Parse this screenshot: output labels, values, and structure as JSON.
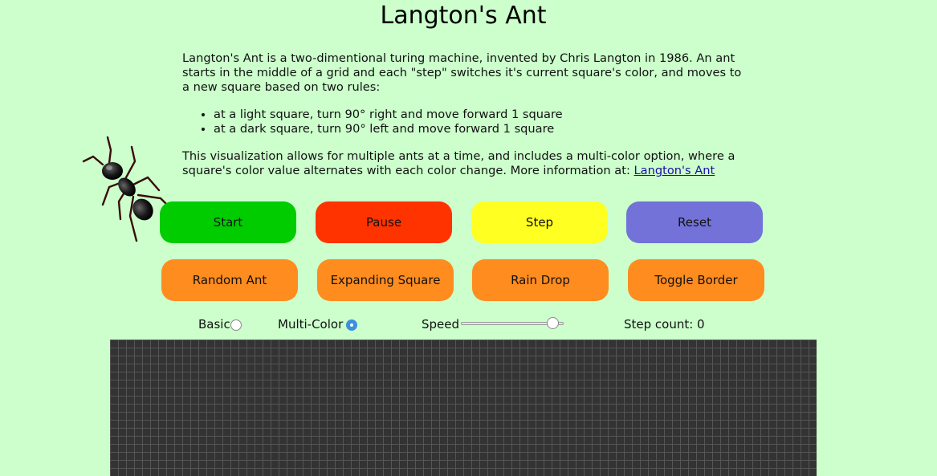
{
  "title": "Langton's Ant",
  "intro": "Langton's Ant is a two-dimentional turing machine, invented by Chris Langton in 1986. An ant starts in the middle of a grid and each \"step\" switches it's current square's color, and moves to a new square based on two rules:",
  "rules": [
    "at a light square, turn 90° right and move forward 1 square",
    "at a dark square, turn 90° left and move forward 1 square"
  ],
  "more_info": "This visualization allows for multiple ants at a time, and includes a multi-color option, where a square's color value alternates with each color change. More information at: ",
  "more_link": "Langton's Ant",
  "buttons_row1": [
    {
      "label": "Start",
      "color": "#00cc00"
    },
    {
      "label": "Pause",
      "color": "#ff3300"
    },
    {
      "label": "Step",
      "color": "#ffff22"
    },
    {
      "label": "Reset",
      "color": "#7272d8"
    }
  ],
  "buttons_row2": [
    {
      "label": "Random Ant",
      "color": "#ff8c1f"
    },
    {
      "label": "Expanding Square",
      "color": "#ff8c1f"
    },
    {
      "label": "Rain Drop",
      "color": "#ff8c1f"
    },
    {
      "label": "Toggle Border",
      "color": "#ff8c1f"
    }
  ],
  "controls": {
    "basic_label": "Basic",
    "basic_checked": false,
    "multicolor_label": "Multi-Color",
    "multicolor_checked": true,
    "speed_label": "Speed",
    "speed_value": 0.95,
    "step_count_label": "Step count: 0"
  },
  "grid": {
    "cell_color": "#333333",
    "line_color": "#555555"
  },
  "icons": {
    "ant": "ant-icon"
  }
}
